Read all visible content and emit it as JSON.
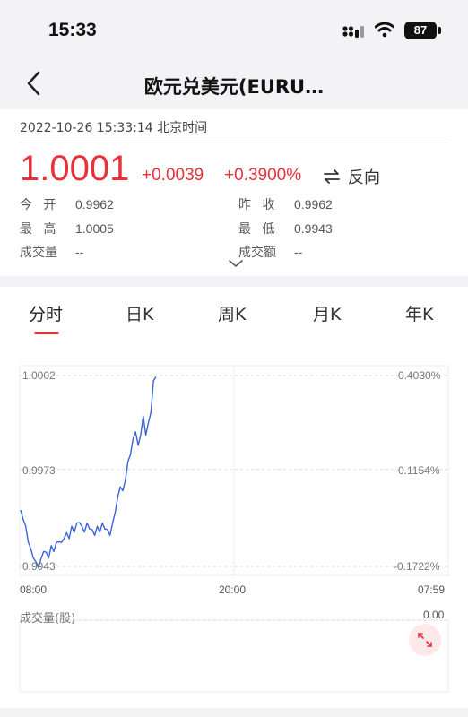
{
  "status_bar": {
    "time": "15:33",
    "battery": "87",
    "icons": [
      "signal-icon",
      "wifi-icon",
      "battery-icon"
    ]
  },
  "nav": {
    "back_icon": "chevron-left-icon",
    "title": "欧元兑美元(EURU…"
  },
  "quote": {
    "timestamp": "2022-10-26 15:33:14  北京时间",
    "price": "1.0001",
    "change": "+0.0039",
    "change_pct": "+0.3900%",
    "reverse_label": "反向",
    "reverse_icon": "swap-arrows-icon",
    "open_label": "今  开",
    "open_value": "0.9962",
    "prev_close_label": "昨  收",
    "prev_close_value": "0.9962",
    "high_label": "最  高",
    "high_value": "1.0005",
    "low_label": "最  低",
    "low_value": "0.9943",
    "volume_label": "成交量",
    "volume_value": "--",
    "turnover_label": "成交额",
    "turnover_value": "--",
    "expand_icon": "chevron-down-icon",
    "up_color": "#e8313b"
  },
  "tabs": [
    {
      "label": "分时",
      "active": true
    },
    {
      "label": "日K",
      "active": false
    },
    {
      "label": "周K",
      "active": false
    },
    {
      "label": "月K",
      "active": false
    },
    {
      "label": "年K",
      "active": false
    }
  ],
  "chart": {
    "y_left_labels": [
      "1.0002",
      "0.9973",
      "0.9943"
    ],
    "y_right_labels": [
      "0.4030%",
      "0.1154%",
      "-0.1722%"
    ],
    "x_labels": [
      "08:00",
      "20:00",
      "07:59"
    ],
    "volume_label": "成交量(股)",
    "volume_value": "0.00",
    "fullscreen_icon": "fullscreen-icon",
    "line_color": "#3a64d8"
  },
  "chart_data": {
    "type": "line",
    "title": "",
    "xlabel": "",
    "ylabel": "",
    "ylim": [
      0.9943,
      1.0002
    ],
    "x_range": [
      "08:00",
      "07:59"
    ],
    "y_ticks": [
      1.0002,
      0.9973,
      0.9943
    ],
    "y2_ticks": [
      "0.4030%",
      "0.1154%",
      "-0.1722%"
    ],
    "x_ticks": [
      "08:00",
      "20:00",
      "07:59"
    ],
    "series": [
      {
        "values": [
          0.996,
          0.9958,
          0.9955,
          0.9951,
          0.9948,
          0.9946,
          0.9944,
          0.9943,
          0.9945,
          0.9948,
          0.9947,
          0.9946,
          0.9949,
          0.9948,
          0.995,
          0.9951,
          0.995,
          0.9952,
          0.9953,
          0.9952,
          0.9955,
          0.9954,
          0.9956,
          0.9957,
          0.9955,
          0.9954,
          0.9956,
          0.9955,
          0.9954,
          0.9953,
          0.9955,
          0.9954,
          0.9956,
          0.9955,
          0.9954,
          0.9953,
          0.9956,
          0.996,
          0.9964,
          0.9968,
          0.9966,
          0.997,
          0.9975,
          0.9978,
          0.9982,
          0.9985,
          0.998,
          0.9984,
          0.9989,
          0.9984,
          0.9987,
          0.9991,
          1.0,
          1.0002
        ]
      }
    ],
    "grid": true,
    "legend": "none"
  }
}
